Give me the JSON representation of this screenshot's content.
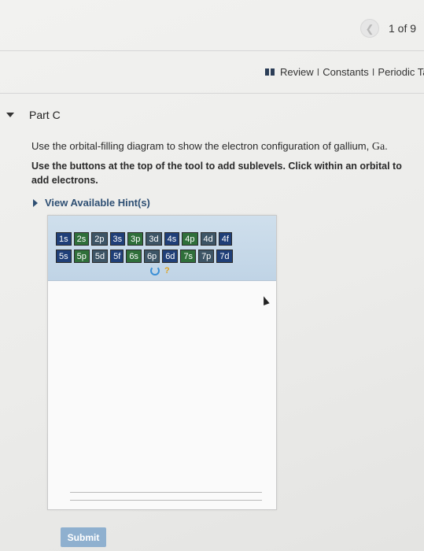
{
  "header": {
    "page_count": "1 of 9",
    "prev_icon": "chevron-left-icon"
  },
  "resources": {
    "review": "Review",
    "separator": "I",
    "constants": "Constants",
    "periodic": "Periodic Tab"
  },
  "part": {
    "title": "Part C"
  },
  "question": {
    "text": "Use the orbital-filling diagram to show the electron configuration of gallium, ",
    "element": "Ga",
    "end": "."
  },
  "instructions": "Use the buttons at the top of the tool to add sublevels. Click within an orbital to add electrons.",
  "hints": {
    "label": "View Available Hint(s)"
  },
  "tool": {
    "row1": [
      "1s",
      "2s",
      "2p",
      "3s",
      "3p",
      "3d",
      "4s",
      "4p",
      "4d",
      "4f"
    ],
    "row2": [
      "5s",
      "5p",
      "5d",
      "5f",
      "6s",
      "6p",
      "6d",
      "7s",
      "7p",
      "7d"
    ],
    "colors": {
      "dark_blue": "#1f3f78",
      "green": "#2f6f3a",
      "slate": "#3d5566"
    }
  },
  "submit": {
    "label": "Submit"
  },
  "colors": {
    "accent": "#2e4f73",
    "submit_bg": "#8fb0cf",
    "toolbar_bg": "#c8dae9"
  }
}
